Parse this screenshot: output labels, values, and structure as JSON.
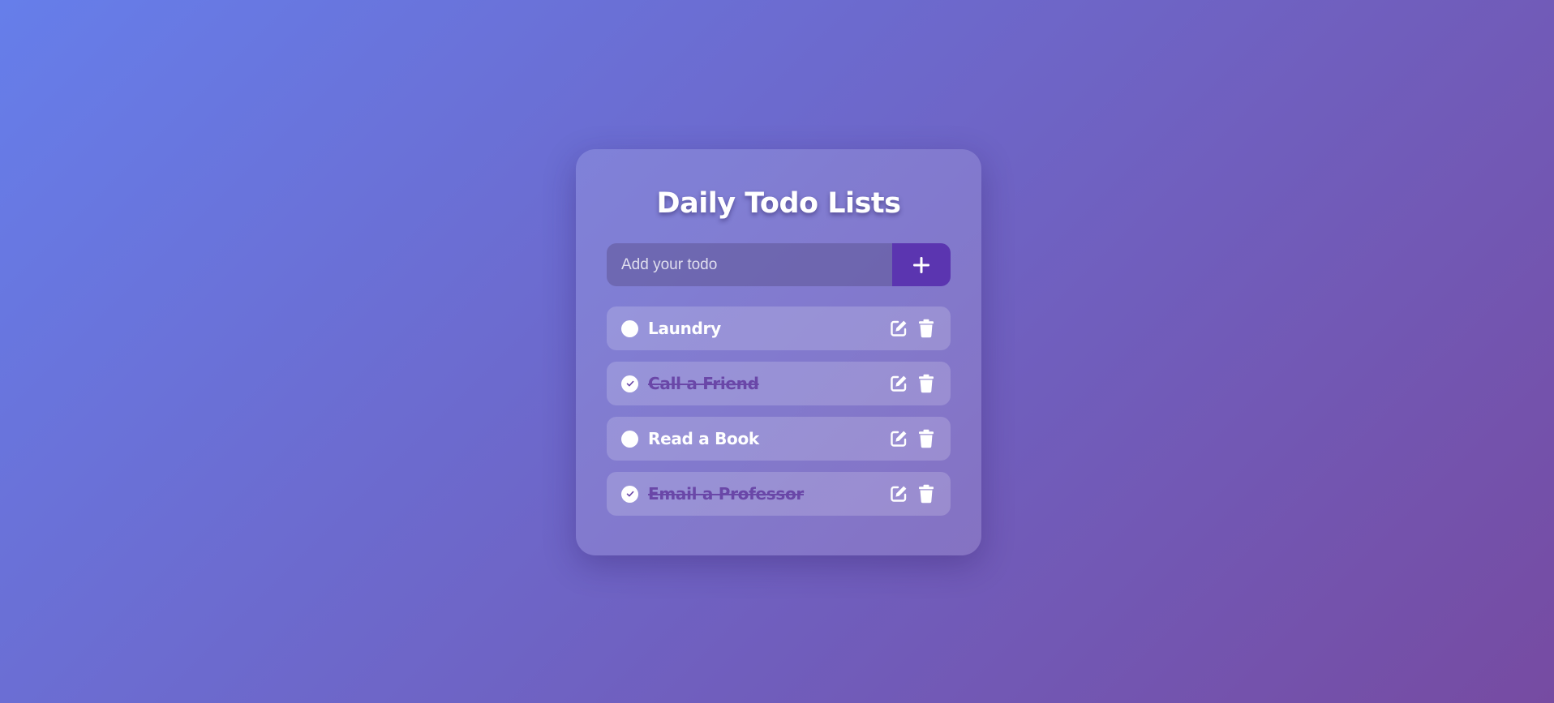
{
  "app": {
    "title": "Daily Todo Lists"
  },
  "input": {
    "placeholder": "Add your todo",
    "value": "",
    "add_icon": "plus-icon"
  },
  "todos": [
    {
      "label": "Laundry",
      "done": false
    },
    {
      "label": "Call a Friend",
      "done": true
    },
    {
      "label": "Read a Book",
      "done": false
    },
    {
      "label": "Email a Professor",
      "done": true
    }
  ],
  "icons": {
    "edit": "edit-icon",
    "delete": "trash-icon",
    "check": "check-icon"
  },
  "colors": {
    "gradient_start": "#667eea",
    "gradient_end": "#764ba2",
    "accent": "#5b35b0",
    "done_text": "#6a47a8"
  }
}
